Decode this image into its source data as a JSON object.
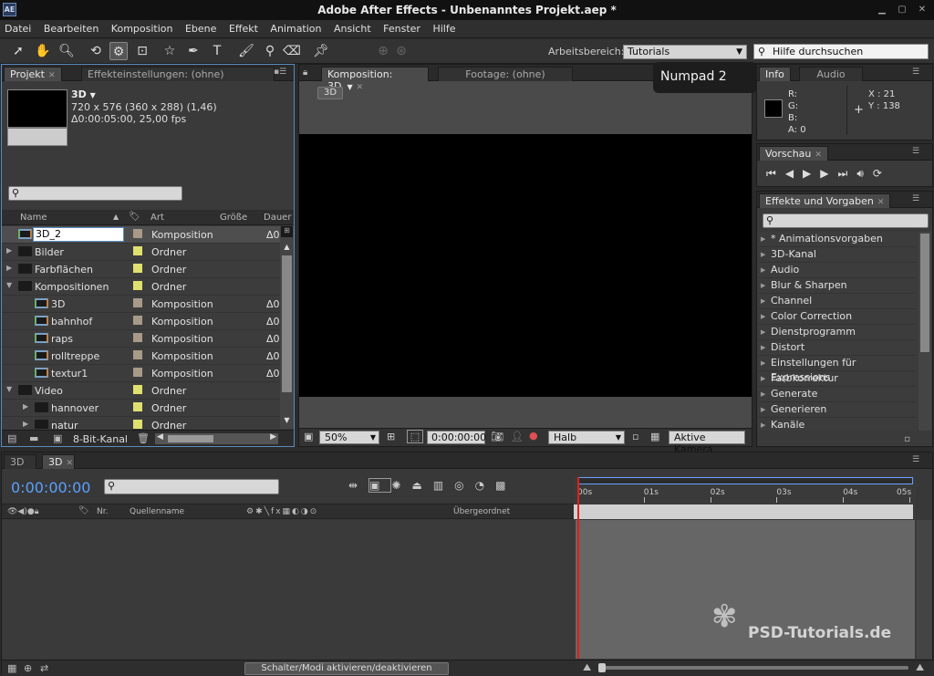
{
  "app": {
    "title": "Adobe After Effects - Unbenanntes Projekt.aep *",
    "logo": "AE"
  },
  "menu": [
    "Datei",
    "Bearbeiten",
    "Komposition",
    "Ebene",
    "Effekt",
    "Animation",
    "Ansicht",
    "Fenster",
    "Hilfe"
  ],
  "toolbar": {
    "workspace_label": "Arbeitsbereich:",
    "workspace_value": "Tutorials",
    "help_placeholder": "Hilfe durchsuchen"
  },
  "tooltip": "Numpad 2",
  "project": {
    "tabs": [
      "Projekt",
      "Effekteinstellungen: (ohne)"
    ],
    "selected_name": "3D",
    "info_line1": "720 x 576 (360 x 288) (1,46)",
    "info_line2": "Δ0:00:05:00, 25,00 fps",
    "columns": [
      "Name",
      "Art",
      "Größe",
      "Dauer"
    ],
    "rows": [
      {
        "name": "3D_2",
        "type": "Komposition",
        "dur": "Δ0",
        "kind": "comp",
        "indent": 0,
        "color": "#a89a88",
        "editing": true
      },
      {
        "name": "Bilder",
        "type": "Ordner",
        "dur": "",
        "kind": "folder",
        "indent": 0,
        "color": "#e0e070"
      },
      {
        "name": "Farbflächen",
        "type": "Ordner",
        "dur": "",
        "kind": "folder",
        "indent": 0,
        "color": "#e0e070"
      },
      {
        "name": "Kompositionen",
        "type": "Ordner",
        "dur": "",
        "kind": "folder",
        "indent": 0,
        "color": "#e0e070",
        "open": true
      },
      {
        "name": "3D",
        "type": "Komposition",
        "dur": "Δ0",
        "kind": "comp",
        "indent": 1,
        "color": "#a89a88"
      },
      {
        "name": "bahnhof",
        "type": "Komposition",
        "dur": "Δ0",
        "kind": "comp",
        "indent": 1,
        "color": "#a89a88"
      },
      {
        "name": "raps",
        "type": "Komposition",
        "dur": "Δ0",
        "kind": "comp",
        "indent": 1,
        "color": "#a89a88"
      },
      {
        "name": "rolltreppe",
        "type": "Komposition",
        "dur": "Δ0",
        "kind": "comp",
        "indent": 1,
        "color": "#a89a88"
      },
      {
        "name": "textur1",
        "type": "Komposition",
        "dur": "Δ0",
        "kind": "comp",
        "indent": 1,
        "color": "#a89a88"
      },
      {
        "name": "Video",
        "type": "Ordner",
        "dur": "",
        "kind": "folder",
        "indent": 0,
        "color": "#e0e070",
        "open": true
      },
      {
        "name": "hannover",
        "type": "Ordner",
        "dur": "",
        "kind": "folder",
        "indent": 1,
        "color": "#e0e070"
      },
      {
        "name": "natur",
        "type": "Ordner",
        "dur": "",
        "kind": "folder",
        "indent": 1,
        "color": "#e0e070"
      }
    ],
    "bitdepth": "8-Bit-Kanal"
  },
  "comp": {
    "tabs": [
      "Komposition: 3D",
      "Footage: (ohne)"
    ],
    "badge": "3D",
    "zoom": "50%",
    "timecode": "0:00:00:00",
    "resolution": "Halb",
    "camera": "Aktive Kamera"
  },
  "info": {
    "tabs": [
      "Info",
      "Audio"
    ],
    "r": "R:",
    "g": "G:",
    "b": "B:",
    "a": "A:  0",
    "x": "X : 21",
    "y": "Y : 138"
  },
  "preview": {
    "tab": "Vorschau"
  },
  "effects": {
    "tab": "Effekte und Vorgaben",
    "items": [
      "* Animationsvorgaben",
      "3D-Kanal",
      "Audio",
      "Blur & Sharpen",
      "Channel",
      "Color Correction",
      "Dienstprogramm",
      "Distort",
      "Einstellungen für Expressions",
      "Farbkorrektur",
      "Generate",
      "Generieren",
      "Kanäle"
    ]
  },
  "timeline": {
    "tabs": [
      "3D",
      "3D"
    ],
    "timecode": "0:00:00:00",
    "columns": {
      "nr": "Nr.",
      "source": "Quellenname",
      "parent": "Übergeordnet"
    },
    "ticks": [
      "00s",
      "01s",
      "02s",
      "03s",
      "04s",
      "05s"
    ],
    "toggle_label": "Schalter/Modi aktivieren/deaktivieren",
    "playhead_fraction": 0.0
  },
  "watermark": "PSD-Tutorials.de"
}
